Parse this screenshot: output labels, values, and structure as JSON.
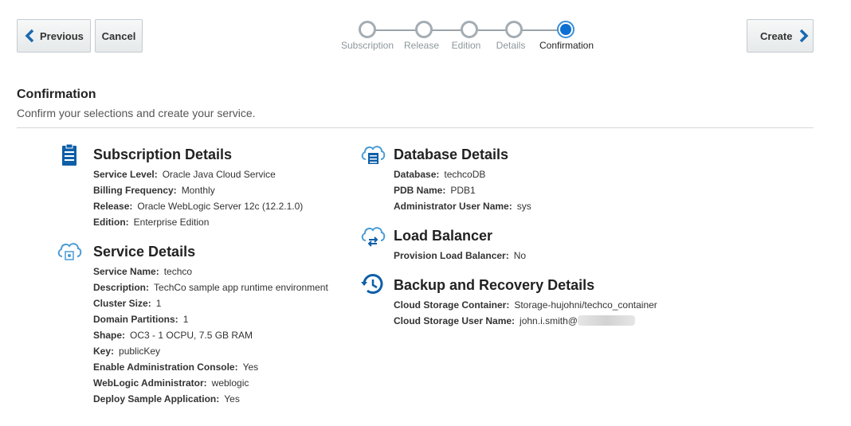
{
  "buttons": {
    "previous": "Previous",
    "cancel": "Cancel",
    "create": "Create"
  },
  "train": {
    "steps": [
      "Subscription",
      "Release",
      "Edition",
      "Details",
      "Confirmation"
    ],
    "current_index": 4
  },
  "header": {
    "title": "Confirmation",
    "subtitle": "Confirm your selections and create your service."
  },
  "subscription": {
    "title": "Subscription Details",
    "rows": [
      {
        "k": "Service Level:",
        "v": "Oracle Java Cloud Service"
      },
      {
        "k": "Billing Frequency:",
        "v": "Monthly"
      },
      {
        "k": "Release:",
        "v": "Oracle WebLogic Server 12c (12.2.1.0)"
      },
      {
        "k": "Edition:",
        "v": "Enterprise Edition"
      }
    ]
  },
  "service": {
    "title": "Service Details",
    "rows": [
      {
        "k": "Service Name:",
        "v": "techco"
      },
      {
        "k": "Description:",
        "v": "TechCo sample app runtime environment"
      },
      {
        "k": "Cluster Size:",
        "v": "1"
      },
      {
        "k": "Domain Partitions:",
        "v": "1"
      },
      {
        "k": "Shape:",
        "v": "OC3 - 1 OCPU, 7.5 GB RAM"
      },
      {
        "k": "Key:",
        "v": "publicKey"
      },
      {
        "k": "Enable Administration Console:",
        "v": "Yes"
      },
      {
        "k": "WebLogic Administrator:",
        "v": "weblogic"
      },
      {
        "k": "Deploy Sample Application:",
        "v": "Yes"
      }
    ]
  },
  "database": {
    "title": "Database Details",
    "rows": [
      {
        "k": "Database:",
        "v": "techcoDB"
      },
      {
        "k": "PDB Name:",
        "v": "PDB1"
      },
      {
        "k": "Administrator User Name:",
        "v": "sys"
      }
    ]
  },
  "load_balancer": {
    "title": "Load Balancer",
    "rows": [
      {
        "k": "Provision Load Balancer:",
        "v": "No"
      }
    ]
  },
  "backup": {
    "title": "Backup and Recovery Details",
    "rows": [
      {
        "k": "Cloud Storage Container:",
        "v": "Storage-hujohni/techco_container"
      },
      {
        "k": "Cloud Storage User Name:",
        "v": "john.i.smith@"
      }
    ]
  },
  "colors": {
    "icon_blue": "#0e5fa8",
    "icon_light": "#4a9bd6",
    "current_step": "#0c6fd2"
  },
  "icons": [
    "chevron-left-icon",
    "chevron-right-icon",
    "clipboard-icon",
    "cloud-service-icon",
    "cloud-database-icon",
    "cloud-load-balancer-icon",
    "backup-clock-icon"
  ]
}
